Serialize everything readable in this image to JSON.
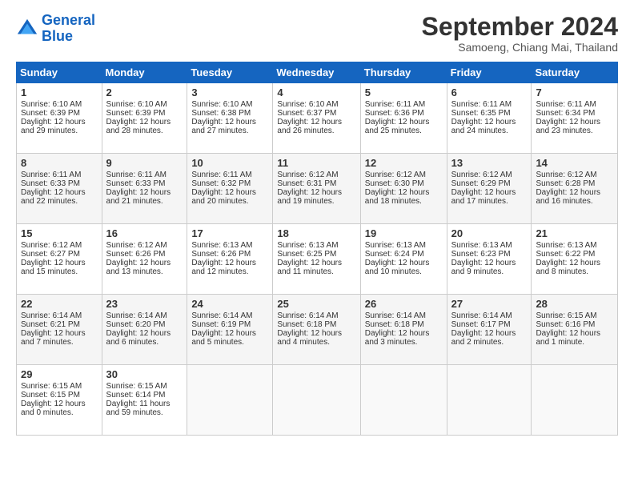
{
  "logo": {
    "line1": "General",
    "line2": "Blue"
  },
  "title": "September 2024",
  "location": "Samoeng, Chiang Mai, Thailand",
  "headers": [
    "Sunday",
    "Monday",
    "Tuesday",
    "Wednesday",
    "Thursday",
    "Friday",
    "Saturday"
  ],
  "weeks": [
    [
      {
        "day": "1",
        "sunrise": "Sunrise: 6:10 AM",
        "sunset": "Sunset: 6:39 PM",
        "daylight": "Daylight: 12 hours and 29 minutes."
      },
      {
        "day": "2",
        "sunrise": "Sunrise: 6:10 AM",
        "sunset": "Sunset: 6:39 PM",
        "daylight": "Daylight: 12 hours and 28 minutes."
      },
      {
        "day": "3",
        "sunrise": "Sunrise: 6:10 AM",
        "sunset": "Sunset: 6:38 PM",
        "daylight": "Daylight: 12 hours and 27 minutes."
      },
      {
        "day": "4",
        "sunrise": "Sunrise: 6:10 AM",
        "sunset": "Sunset: 6:37 PM",
        "daylight": "Daylight: 12 hours and 26 minutes."
      },
      {
        "day": "5",
        "sunrise": "Sunrise: 6:11 AM",
        "sunset": "Sunset: 6:36 PM",
        "daylight": "Daylight: 12 hours and 25 minutes."
      },
      {
        "day": "6",
        "sunrise": "Sunrise: 6:11 AM",
        "sunset": "Sunset: 6:35 PM",
        "daylight": "Daylight: 12 hours and 24 minutes."
      },
      {
        "day": "7",
        "sunrise": "Sunrise: 6:11 AM",
        "sunset": "Sunset: 6:34 PM",
        "daylight": "Daylight: 12 hours and 23 minutes."
      }
    ],
    [
      {
        "day": "8",
        "sunrise": "Sunrise: 6:11 AM",
        "sunset": "Sunset: 6:33 PM",
        "daylight": "Daylight: 12 hours and 22 minutes."
      },
      {
        "day": "9",
        "sunrise": "Sunrise: 6:11 AM",
        "sunset": "Sunset: 6:33 PM",
        "daylight": "Daylight: 12 hours and 21 minutes."
      },
      {
        "day": "10",
        "sunrise": "Sunrise: 6:11 AM",
        "sunset": "Sunset: 6:32 PM",
        "daylight": "Daylight: 12 hours and 20 minutes."
      },
      {
        "day": "11",
        "sunrise": "Sunrise: 6:12 AM",
        "sunset": "Sunset: 6:31 PM",
        "daylight": "Daylight: 12 hours and 19 minutes."
      },
      {
        "day": "12",
        "sunrise": "Sunrise: 6:12 AM",
        "sunset": "Sunset: 6:30 PM",
        "daylight": "Daylight: 12 hours and 18 minutes."
      },
      {
        "day": "13",
        "sunrise": "Sunrise: 6:12 AM",
        "sunset": "Sunset: 6:29 PM",
        "daylight": "Daylight: 12 hours and 17 minutes."
      },
      {
        "day": "14",
        "sunrise": "Sunrise: 6:12 AM",
        "sunset": "Sunset: 6:28 PM",
        "daylight": "Daylight: 12 hours and 16 minutes."
      }
    ],
    [
      {
        "day": "15",
        "sunrise": "Sunrise: 6:12 AM",
        "sunset": "Sunset: 6:27 PM",
        "daylight": "Daylight: 12 hours and 15 minutes."
      },
      {
        "day": "16",
        "sunrise": "Sunrise: 6:12 AM",
        "sunset": "Sunset: 6:26 PM",
        "daylight": "Daylight: 12 hours and 13 minutes."
      },
      {
        "day": "17",
        "sunrise": "Sunrise: 6:13 AM",
        "sunset": "Sunset: 6:26 PM",
        "daylight": "Daylight: 12 hours and 12 minutes."
      },
      {
        "day": "18",
        "sunrise": "Sunrise: 6:13 AM",
        "sunset": "Sunset: 6:25 PM",
        "daylight": "Daylight: 12 hours and 11 minutes."
      },
      {
        "day": "19",
        "sunrise": "Sunrise: 6:13 AM",
        "sunset": "Sunset: 6:24 PM",
        "daylight": "Daylight: 12 hours and 10 minutes."
      },
      {
        "day": "20",
        "sunrise": "Sunrise: 6:13 AM",
        "sunset": "Sunset: 6:23 PM",
        "daylight": "Daylight: 12 hours and 9 minutes."
      },
      {
        "day": "21",
        "sunrise": "Sunrise: 6:13 AM",
        "sunset": "Sunset: 6:22 PM",
        "daylight": "Daylight: 12 hours and 8 minutes."
      }
    ],
    [
      {
        "day": "22",
        "sunrise": "Sunrise: 6:14 AM",
        "sunset": "Sunset: 6:21 PM",
        "daylight": "Daylight: 12 hours and 7 minutes."
      },
      {
        "day": "23",
        "sunrise": "Sunrise: 6:14 AM",
        "sunset": "Sunset: 6:20 PM",
        "daylight": "Daylight: 12 hours and 6 minutes."
      },
      {
        "day": "24",
        "sunrise": "Sunrise: 6:14 AM",
        "sunset": "Sunset: 6:19 PM",
        "daylight": "Daylight: 12 hours and 5 minutes."
      },
      {
        "day": "25",
        "sunrise": "Sunrise: 6:14 AM",
        "sunset": "Sunset: 6:18 PM",
        "daylight": "Daylight: 12 hours and 4 minutes."
      },
      {
        "day": "26",
        "sunrise": "Sunrise: 6:14 AM",
        "sunset": "Sunset: 6:18 PM",
        "daylight": "Daylight: 12 hours and 3 minutes."
      },
      {
        "day": "27",
        "sunrise": "Sunrise: 6:14 AM",
        "sunset": "Sunset: 6:17 PM",
        "daylight": "Daylight: 12 hours and 2 minutes."
      },
      {
        "day": "28",
        "sunrise": "Sunrise: 6:15 AM",
        "sunset": "Sunset: 6:16 PM",
        "daylight": "Daylight: 12 hours and 1 minute."
      }
    ],
    [
      {
        "day": "29",
        "sunrise": "Sunrise: 6:15 AM",
        "sunset": "Sunset: 6:15 PM",
        "daylight": "Daylight: 12 hours and 0 minutes."
      },
      {
        "day": "30",
        "sunrise": "Sunrise: 6:15 AM",
        "sunset": "Sunset: 6:14 PM",
        "daylight": "Daylight: 11 hours and 59 minutes."
      },
      null,
      null,
      null,
      null,
      null
    ]
  ]
}
